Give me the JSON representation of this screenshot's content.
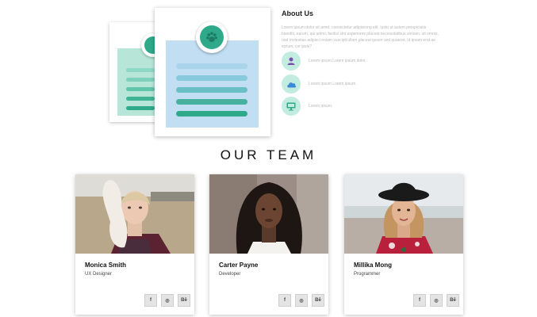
{
  "about": {
    "title": "About Us",
    "text": "Lorem ipsum dolor sit amet, consectetur adipisicing elit. Iusto ut autem perspiciatis blanditi, earum, qui animi, facilisi sint asperiores placeat necessitatibus veniam, sit omnis, uod molestias adipisci eniam suscipit ullam placeat ipsum sed quaerat, ut ipsam erat ae eorum, cor ipsis?",
    "features": [
      {
        "icon": "user-icon",
        "label": "Lorem ipsum Lorem ipsum dolor."
      },
      {
        "icon": "cloud-icon",
        "label": "Lorem ipsum Lorem ipsum."
      },
      {
        "icon": "monitor-icon",
        "label": "Lorem ipsum."
      }
    ]
  },
  "team": {
    "title": "OUR TEAM",
    "members": [
      {
        "name": "Monica Smith",
        "role": "UX Designer"
      },
      {
        "name": "Carter Payne",
        "role": "Developer"
      },
      {
        "name": "Millika Mong",
        "role": "Programmer"
      }
    ],
    "social": {
      "facebook": "f",
      "dribbble": "◎",
      "behance": "Bē"
    }
  },
  "colors": {
    "accent_green": "#2ea98a",
    "mint": "#c3ece1",
    "sheet_blue": "#c2def3",
    "icon_purple": "#7a4fb0",
    "icon_blue": "#3a88d8"
  }
}
